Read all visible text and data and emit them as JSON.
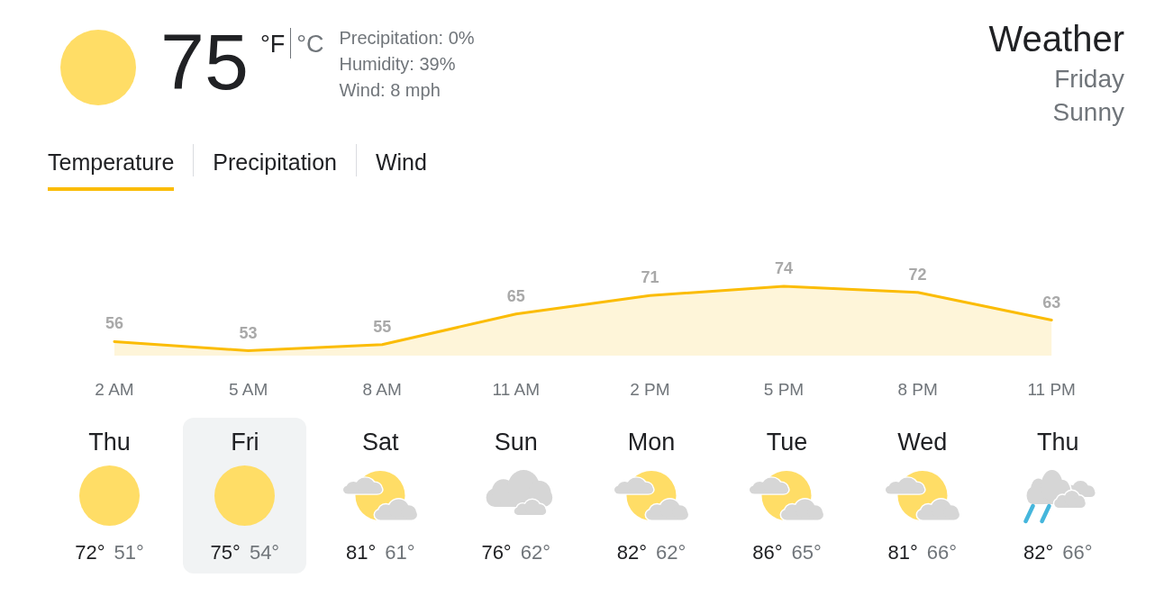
{
  "current": {
    "kind": "sunny",
    "temperature": "75",
    "units": [
      {
        "label": "°F",
        "selected": true
      },
      {
        "label": "°C",
        "selected": false
      }
    ],
    "details": [
      "Precipitation: 0%",
      "Humidity: 39%",
      "Wind: 8 mph"
    ]
  },
  "header": {
    "title": "Weather",
    "day": "Friday",
    "condition_text": "Sunny"
  },
  "tabs": [
    {
      "label": "Temperature",
      "selected": true
    },
    {
      "label": "Precipitation",
      "selected": false
    },
    {
      "label": "Wind",
      "selected": false
    }
  ],
  "chart": {
    "chart_data": {
      "type": "area",
      "categories": [
        "2 AM",
        "5 AM",
        "8 AM",
        "11 AM",
        "2 PM",
        "5 PM",
        "8 PM",
        "11 PM"
      ],
      "values": [
        56,
        53,
        55,
        65,
        71,
        74,
        72,
        63
      ],
      "data_labels": true
    }
  },
  "days": [
    {
      "name": "Thu",
      "kind": "sunny",
      "high": "72°",
      "low": "51°",
      "selected": false
    },
    {
      "name": "Fri",
      "kind": "sunny",
      "high": "75°",
      "low": "54°",
      "selected": true
    },
    {
      "name": "Sat",
      "kind": "partly_cloudy",
      "high": "81°",
      "low": "61°",
      "selected": false
    },
    {
      "name": "Sun",
      "kind": "cloudy",
      "high": "76°",
      "low": "62°",
      "selected": false
    },
    {
      "name": "Mon",
      "kind": "partly_cloudy",
      "high": "82°",
      "low": "62°",
      "selected": false
    },
    {
      "name": "Tue",
      "kind": "partly_cloudy",
      "high": "86°",
      "low": "65°",
      "selected": false
    },
    {
      "name": "Wed",
      "kind": "partly_cloudy",
      "high": "81°",
      "low": "66°",
      "selected": false
    },
    {
      "name": "Thu",
      "kind": "rain",
      "high": "82°",
      "low": "66°",
      "selected": false
    }
  ]
}
